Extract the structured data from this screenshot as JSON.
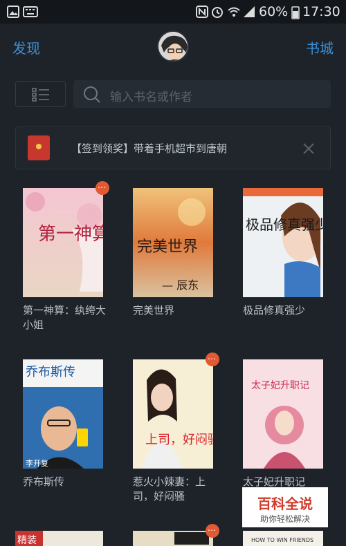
{
  "status_bar": {
    "battery": "60%",
    "time": "17:30"
  },
  "header": {
    "left_tab": "发现",
    "right_tab": "书城"
  },
  "search": {
    "placeholder": "输入书名或作者"
  },
  "banner": {
    "text": "【签到领奖】带着手机超市到唐朝"
  },
  "books": [
    {
      "title": "第一神算：纨绔大小姐",
      "cover_text": "第一神算",
      "has_badge": true
    },
    {
      "title": "完美世界",
      "cover_text": "完美世界",
      "cover_sub": "— 辰东",
      "has_badge": false
    },
    {
      "title": "极品修真强少",
      "cover_text": "极品修真强少",
      "has_badge": false
    },
    {
      "title": "乔布斯传",
      "cover_text": "乔布斯传",
      "cover_sub": "李开复",
      "has_badge": false
    },
    {
      "title": "惹火小辣妻：上司，好闷骚",
      "cover_text": "上司，好闷骚",
      "has_badge": true
    },
    {
      "title": "太子妃升职记",
      "cover_text": "太子妃升职记",
      "has_badge": false
    },
    {
      "cover_text": "精装",
      "has_badge": false
    },
    {
      "cover_text": "",
      "has_badge": true
    },
    {
      "cover_text": "HOW TO WIN FRIENDS",
      "has_badge": false
    }
  ],
  "watermark": {
    "line1": "百科全说",
    "line2": "助你轻松解决"
  },
  "colors": {
    "background": "#1e2329",
    "accent": "#3d8fd6",
    "badge": "#e05a33"
  }
}
